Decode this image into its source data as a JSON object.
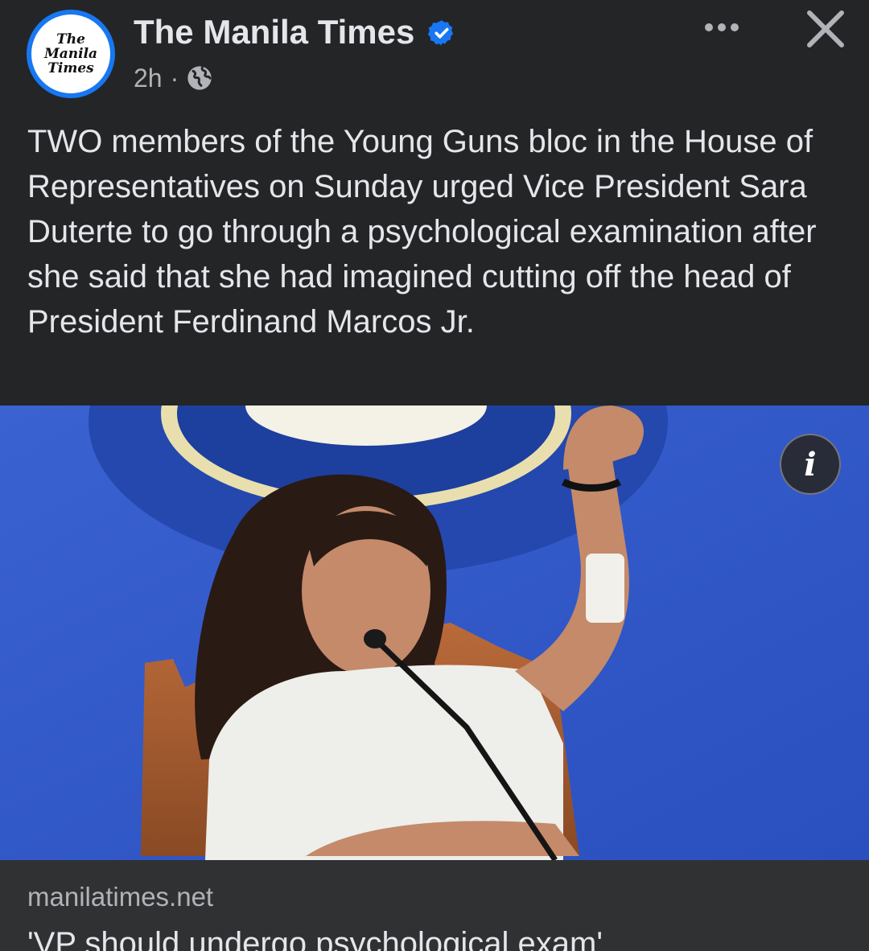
{
  "post": {
    "page_name": "The Manila Times",
    "avatar_lines": [
      "The",
      "Manila",
      "Times"
    ],
    "time": "2h",
    "separator": "·",
    "privacy_icon": "globe-icon",
    "verified_icon": "verified-badge-icon",
    "more_icon": "more-options-icon",
    "close_icon": "close-icon",
    "text": "TWO members of the Young Guns bloc in the House of Representatives on Sunday urged Vice President Sara Duterte to go through a psychological examination after she said that she had imagined cutting off the head of President Ferdinand Marcos Jr.",
    "info_label": "i"
  },
  "link_preview": {
    "domain": "manilatimes.net",
    "title": "'VP should undergo psychological exam'"
  },
  "colors": {
    "background": "#242526",
    "accent": "#1877f2",
    "text_primary": "#e4e6eb",
    "text_secondary": "#b0b3b8",
    "preview_background": "#303133"
  }
}
